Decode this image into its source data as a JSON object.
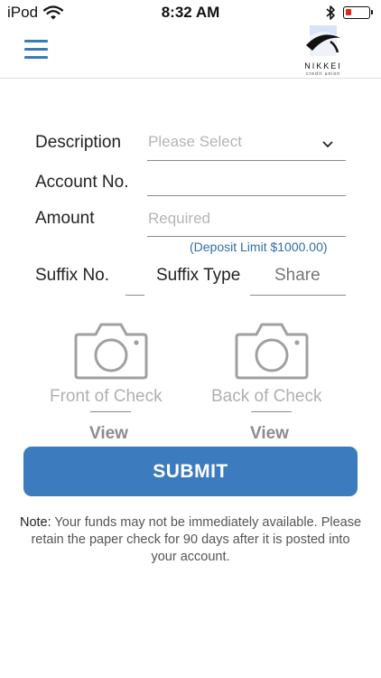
{
  "status_bar": {
    "carrier": "iPod",
    "time": "8:32 AM"
  },
  "logo": {
    "name": "NIKKEI",
    "subtitle": "credit union"
  },
  "form": {
    "description": {
      "label": "Description",
      "placeholder": "Please Select"
    },
    "account_no": {
      "label": "Account No.",
      "value": ""
    },
    "amount": {
      "label": "Amount",
      "placeholder": "Required",
      "hint": "(Deposit Limit $1000.00)"
    },
    "suffix_no": {
      "label": "Suffix No.",
      "value": ""
    },
    "suffix_type": {
      "label": "Suffix Type",
      "value": "Share"
    }
  },
  "checks": {
    "front": {
      "label": "Front of Check",
      "view": "View"
    },
    "back": {
      "label": "Back of Check",
      "view": "View"
    }
  },
  "submit_label": "SUBMIT",
  "note": {
    "prefix": "Note:",
    "text": "Your funds may not be immediately available. Please retain the paper check for 90 days after it is posted into your account."
  },
  "colors": {
    "accent": "#3d7bbf",
    "hint": "#2f6ea8",
    "battery_low": "#e4251b"
  }
}
